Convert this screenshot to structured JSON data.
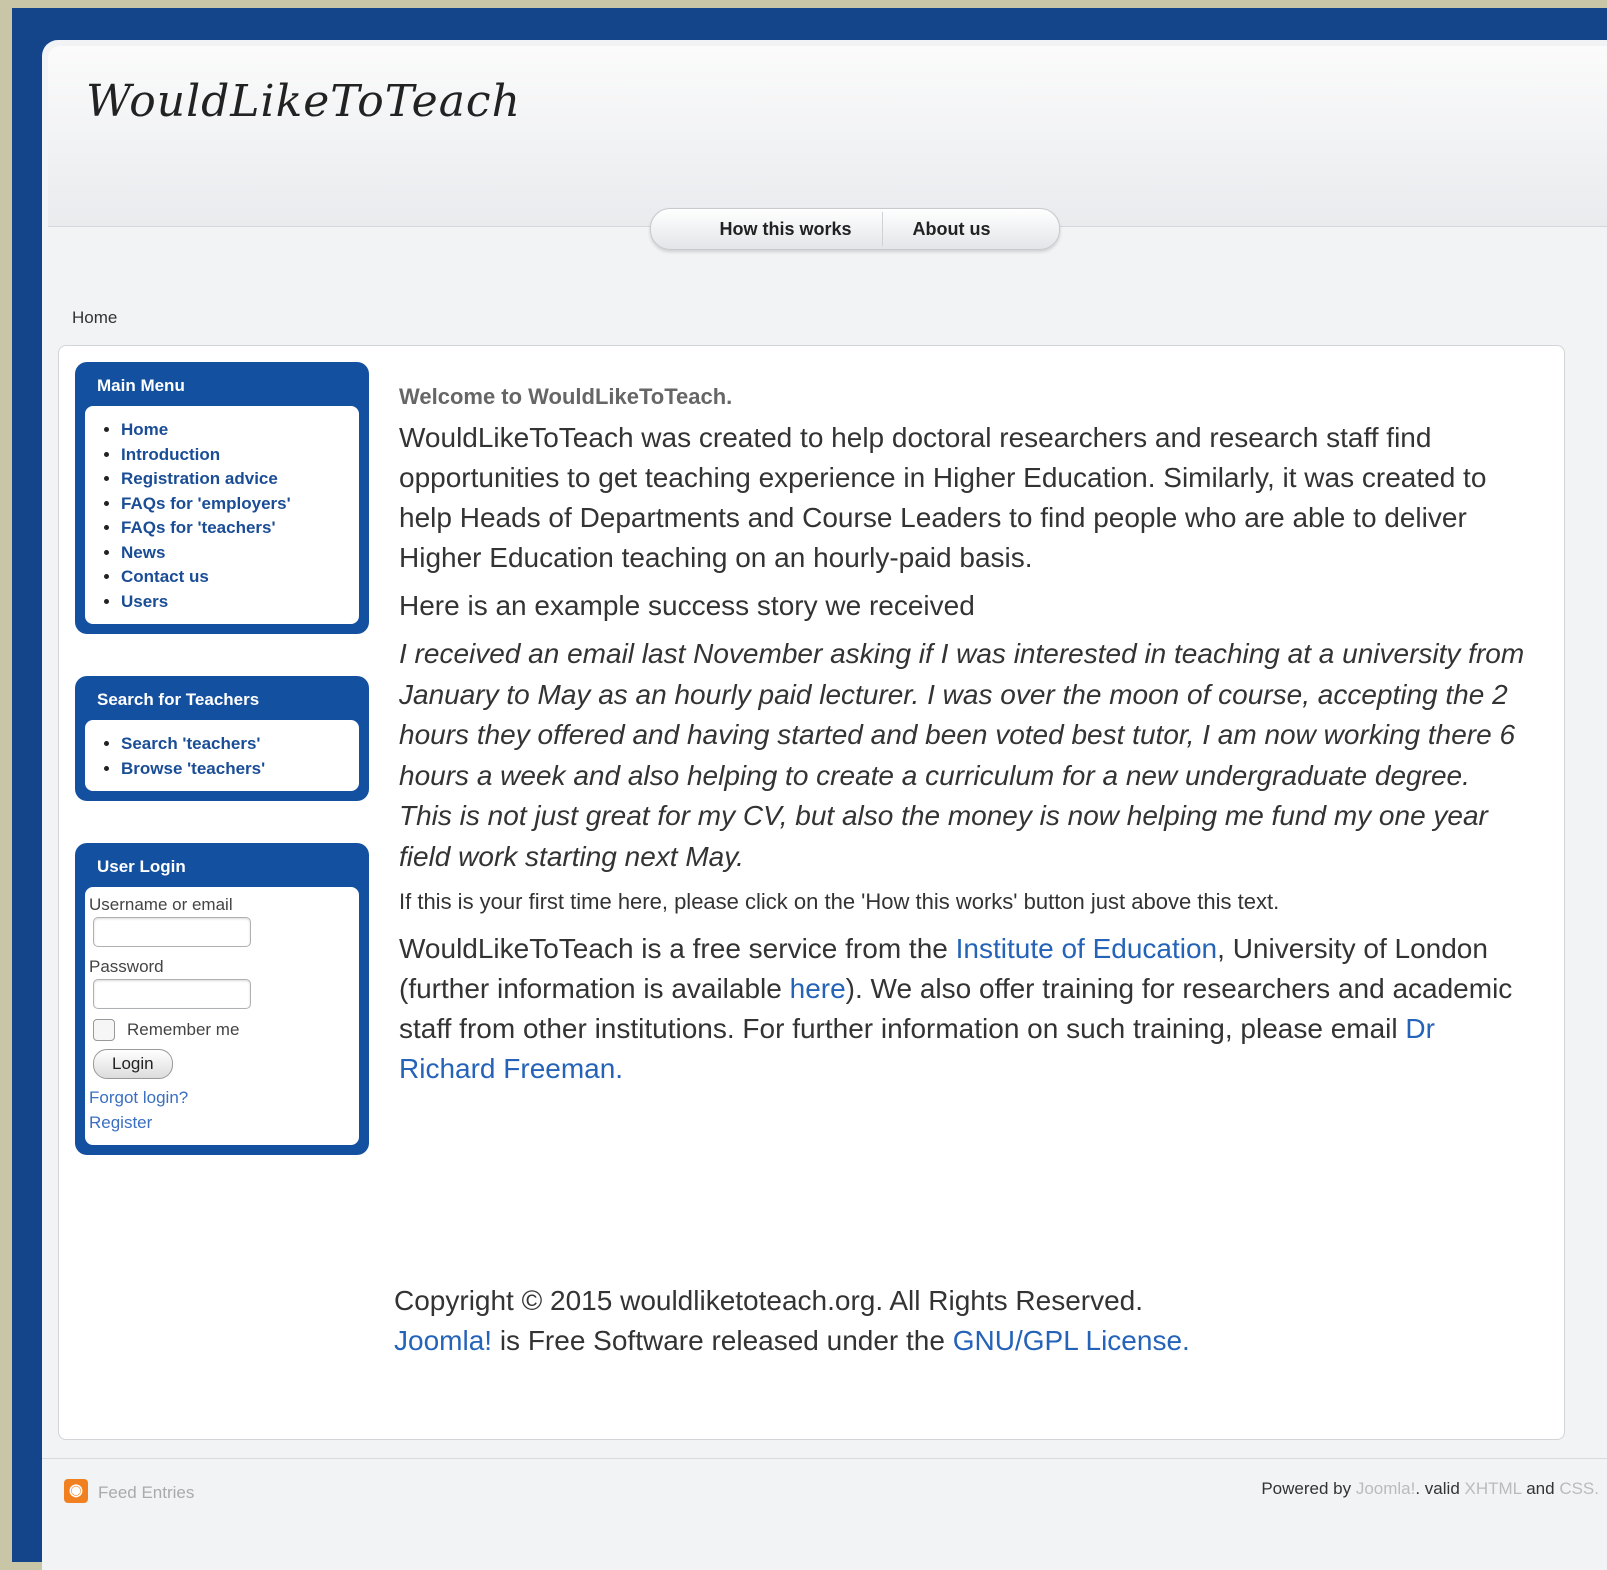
{
  "site": {
    "logo": "WouldLikeToTeach"
  },
  "topnav": [
    {
      "label": "How this works"
    },
    {
      "label": "About us"
    }
  ],
  "breadcrumb": "Home",
  "main_menu": {
    "title": "Main Menu",
    "items": [
      "Home",
      "Introduction",
      "Registration advice",
      "FAQs for 'employers'",
      "FAQs for 'teachers'",
      "News",
      "Contact us",
      "Users"
    ]
  },
  "search_menu": {
    "title": "Search for Teachers",
    "items": [
      "Search 'teachers'",
      "Browse 'teachers'"
    ]
  },
  "login": {
    "title": "User Login",
    "username_label": "Username or email",
    "password_label": "Password",
    "remember_label": "Remember me",
    "button_label": "Login",
    "forgot_label": "Forgot login?",
    "register_label": "Register"
  },
  "content": {
    "heading": "Welcome to WouldLikeToTeach.",
    "intro": "WouldLikeToTeach was created to help doctoral researchers and research staff find opportunities to get teaching experience in Higher Education. Similarly, it was created to help Heads of Departments and Course Leaders to find people who are able to deliver Higher Education teaching on an hourly-paid basis.",
    "story_intro": "Here is an example success story we received",
    "quote": "I received an email last November asking if I was interested in teaching at a university from January to May as an hourly paid lecturer. I was over the moon of course, accepting the 2 hours they offered and having started and been voted best tutor, I am now working there 6 hours a week and also helping to create a curriculum for a new undergraduate degree. This is not just great for my CV, but also the money is now helping me fund my one year field work starting next May.",
    "first_time": "If this is your first time here, please click on the 'How this works' button just above this text.",
    "service_1": "WouldLikeToTeach is a free service from the ",
    "service_link_ioe": "Institute of Education",
    "service_2": ", University of London (further information is available ",
    "service_link_here": "here",
    "service_3": "). We also offer training for researchers and academic staff from other institutions. For further information on such training, please email ",
    "service_link_email": "Dr Richard Freeman."
  },
  "copyright": {
    "line1": "Copyright © 2015 wouldliketoteach.org. All Rights Reserved.",
    "joomla": "Joomla!",
    "line2": " is Free Software released under the ",
    "license": "GNU/GPL License."
  },
  "footer": {
    "feed": "Feed Entries",
    "powered_by": "Powered by ",
    "joomla": "Joomla!",
    "valid": ". valid ",
    "xhtml": "XHTML",
    "and": " and ",
    "css": "CSS."
  },
  "colors": {
    "frame": "#14448a",
    "module": "#1450a0",
    "link": "#2563b8",
    "page_bg": "#c9c6a8"
  }
}
